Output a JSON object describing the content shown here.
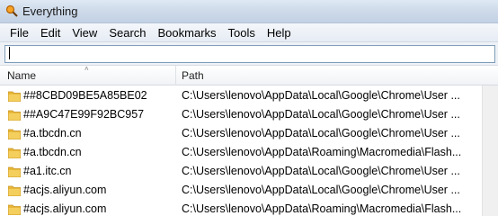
{
  "window": {
    "title": "Everything"
  },
  "menu": [
    "File",
    "Edit",
    "View",
    "Search",
    "Bookmarks",
    "Tools",
    "Help"
  ],
  "search": {
    "value": "",
    "placeholder": ""
  },
  "columns": {
    "name": "Name",
    "path": "Path",
    "sort_indicator": "˄"
  },
  "rows": [
    {
      "name": "##8CBD09BE5A85BE02",
      "path": "C:\\Users\\lenovo\\AppData\\Local\\Google\\Chrome\\User ..."
    },
    {
      "name": "##A9C47E99F92BC957",
      "path": "C:\\Users\\lenovo\\AppData\\Local\\Google\\Chrome\\User ..."
    },
    {
      "name": "#a.tbcdn.cn",
      "path": "C:\\Users\\lenovo\\AppData\\Local\\Google\\Chrome\\User ..."
    },
    {
      "name": "#a.tbcdn.cn",
      "path": "C:\\Users\\lenovo\\AppData\\Roaming\\Macromedia\\Flash..."
    },
    {
      "name": "#a1.itc.cn",
      "path": "C:\\Users\\lenovo\\AppData\\Local\\Google\\Chrome\\User ..."
    },
    {
      "name": "#acjs.aliyun.com",
      "path": "C:\\Users\\lenovo\\AppData\\Local\\Google\\Chrome\\User ..."
    },
    {
      "name": "#acjs.aliyun.com",
      "path": "C:\\Users\\lenovo\\AppData\\Roaming\\Macromedia\\Flash..."
    }
  ],
  "colors": {
    "folder": "#e8b83a",
    "folder_dark": "#c8921c",
    "accent": "#3c7fb1"
  },
  "icons": {
    "app": "magnifier-icon",
    "folder": "folder-icon"
  }
}
